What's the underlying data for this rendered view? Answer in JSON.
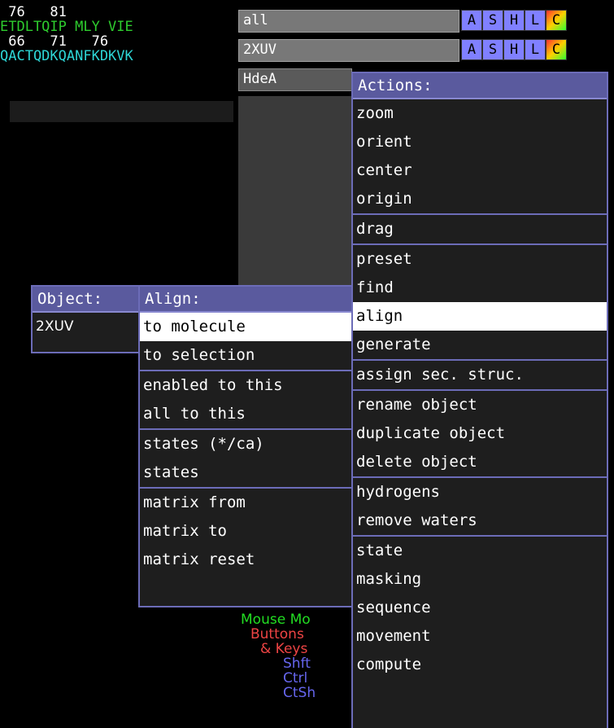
{
  "sequence": {
    "line1_numbers": " 76   81",
    "line2": "ETDLTQIP MLY VIE",
    "line3_numbers": " 66   71   76",
    "line4": "QACTQDKQANFKDKVK"
  },
  "objects": {
    "all": "all",
    "obj1": "2XUV",
    "obj2": "HdeA",
    "buttons": [
      "A",
      "S",
      "H",
      "L",
      "C"
    ]
  },
  "actions_menu": {
    "title": "Actions:",
    "groups": [
      [
        "zoom",
        "orient",
        "center",
        "origin"
      ],
      [
        "drag"
      ],
      [
        "preset",
        "find",
        "align",
        "generate"
      ],
      [
        "assign sec. struc."
      ],
      [
        "rename object",
        "duplicate object",
        "delete object"
      ],
      [
        "hydrogens",
        "remove waters"
      ],
      [
        "state",
        "masking",
        "sequence",
        "movement",
        "compute"
      ]
    ],
    "selected": "align"
  },
  "object_menu": {
    "title": "Object:",
    "value": "2XUV"
  },
  "align_menu": {
    "title": "Align:",
    "groups": [
      [
        "to molecule",
        "to selection"
      ],
      [
        "enabled to this",
        "all to this"
      ],
      [
        "states (*/ca)",
        "states"
      ],
      [
        "matrix from",
        "matrix to",
        "matrix reset"
      ]
    ],
    "selected": "to molecule"
  },
  "mouse_mode": {
    "title": "Mouse Mo",
    "buttons": "Buttons",
    "keys": "& Keys",
    "shft": "Shft",
    "ctrl": "Ctrl",
    "ctsh": "CtSh"
  },
  "colors": {
    "menu_border": "#6c6cb8",
    "menu_title_bg": "#5a5a9e",
    "seq_green": "#2ecc2e",
    "seq_cyan": "#2ed6d6",
    "mouse_green": "#22dd22",
    "mouse_red": "#ee4444",
    "mouse_blue": "#6666ee"
  }
}
